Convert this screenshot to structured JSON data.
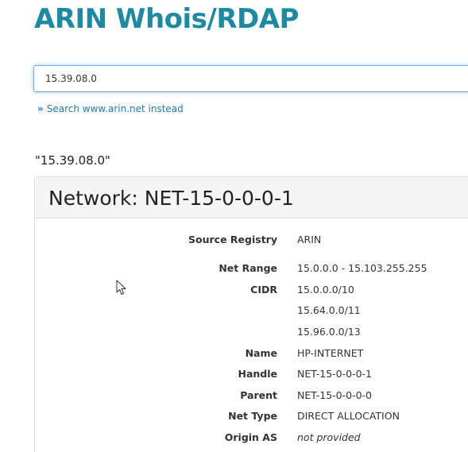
{
  "header": {
    "title": "ARIN Whois/RDAP"
  },
  "search": {
    "value": "15.39.08.0",
    "alt_link_label": "Search www.arin.net instead",
    "alt_link_icon": "double-chevron-right-icon"
  },
  "results": {
    "query_label": "\"15.39.08.0\"",
    "panel_title": "Network: NET-15-0-0-0-1",
    "fields": {
      "source_registry": {
        "label": "Source Registry",
        "value": "ARIN"
      },
      "net_range": {
        "label": "Net Range",
        "value": "15.0.0.0 - 15.103.255.255"
      },
      "cidr": {
        "label": "CIDR",
        "values": [
          "15.0.0.0/10",
          "15.64.0.0/11",
          "15.96.0.0/13"
        ]
      },
      "name": {
        "label": "Name",
        "value": "HP-INTERNET"
      },
      "handle": {
        "label": "Handle",
        "value": "NET-15-0-0-0-1"
      },
      "parent": {
        "label": "Parent",
        "value": "NET-15-0-0-0-0"
      },
      "net_type": {
        "label": "Net Type",
        "value": "DIRECT ALLOCATION"
      },
      "origin_as": {
        "label": "Origin AS",
        "value": "not provided"
      }
    }
  },
  "colors": {
    "brand": "#1d8aa4",
    "link": "#1d7bb5",
    "focus_border": "#66afe9",
    "panel_heading_bg": "#f5f5f5",
    "panel_border": "#dddddd"
  }
}
